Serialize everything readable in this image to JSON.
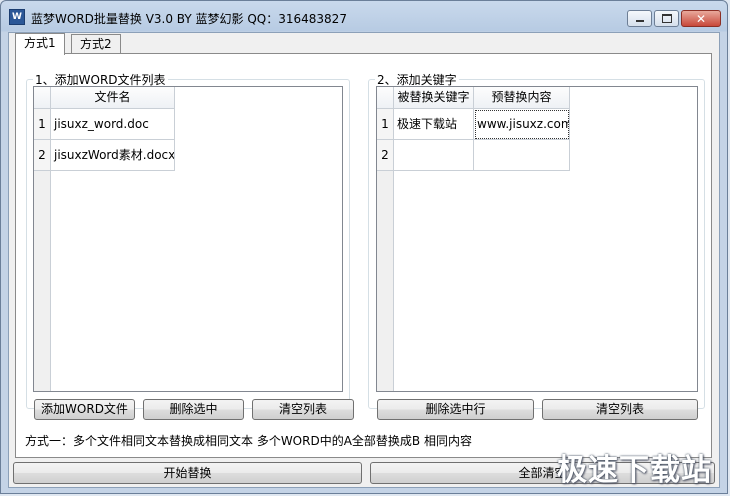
{
  "window": {
    "icon_label": "W",
    "title": "蓝梦WORD批量替换 V3.0 BY 蓝梦幻影 QQ：316483827",
    "controls": {
      "minimize": "",
      "maximize": "",
      "close": "✕"
    }
  },
  "tabs": [
    {
      "label": "方式1",
      "active": true
    },
    {
      "label": "方式2",
      "active": false
    }
  ],
  "files_panel": {
    "legend": "1、添加WORD文件列表",
    "column_header": "文件名",
    "rows": [
      {
        "num": "1",
        "name": "jisuxz_word.doc"
      },
      {
        "num": "2",
        "name": "jisuxzWord素材.docx"
      }
    ],
    "buttons": {
      "add": "添加WORD文件",
      "delete": "删除选中",
      "clear": "清空列表"
    }
  },
  "keywords_panel": {
    "legend": "2、添加关键字",
    "headers": {
      "find": "被替换关键字",
      "replace": "预替换内容"
    },
    "rows": [
      {
        "num": "1",
        "find": "极速下载站",
        "replace": "www.jisuxz.com"
      },
      {
        "num": "2",
        "find": "",
        "replace": ""
      }
    ],
    "buttons": {
      "delete_row": "删除选中行",
      "clear": "清空列表"
    }
  },
  "hint": "方式一：多个文件相同文本替换成相同文本   多个WORD中的A全部替换成B 相同内容",
  "bottom_buttons": {
    "start": "开始替换",
    "clear_all": "全部清空"
  },
  "watermark": "极速下载站"
}
